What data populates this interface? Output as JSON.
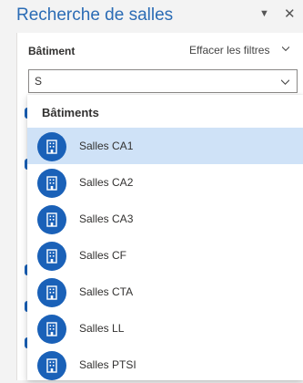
{
  "pane": {
    "title": "Recherche de salles"
  },
  "filters": {
    "building_label": "Bâtiment",
    "clear_label": "Effacer les filtres",
    "search_value": "S"
  },
  "dropdown": {
    "group_label": "Bâtiments",
    "selected_index": 0,
    "items": [
      {
        "label": "Salles CA1",
        "icon": "building-icon"
      },
      {
        "label": "Salles CA2",
        "icon": "building-icon"
      },
      {
        "label": "Salles CA3",
        "icon": "building-icon"
      },
      {
        "label": "Salles CF",
        "icon": "building-icon"
      },
      {
        "label": "Salles CTA",
        "icon": "building-icon"
      },
      {
        "label": "Salles LL",
        "icon": "building-icon"
      },
      {
        "label": "Salles PTSI",
        "icon": "building-icon"
      }
    ]
  },
  "colors": {
    "accent": "#2b6cb5",
    "badge": "#1a61b8",
    "selected_row": "#cfe2f7"
  }
}
